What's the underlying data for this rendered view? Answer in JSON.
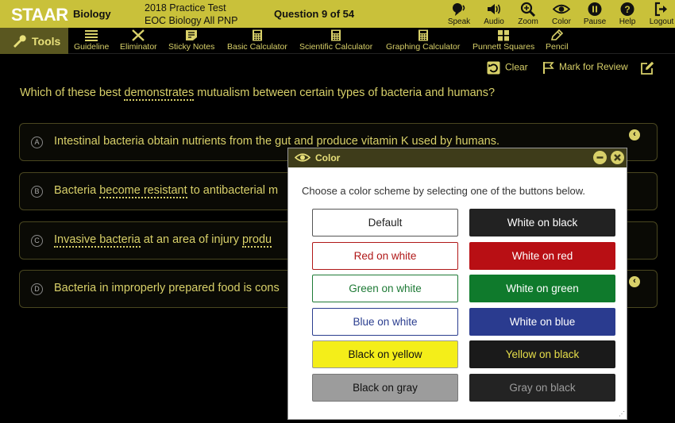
{
  "header": {
    "logo": "STAAR",
    "subject": "Biology",
    "test_line1": "2018 Practice Test",
    "test_line2": "EOC Biology All PNP",
    "question_count": "Question 9 of 54",
    "buttons": [
      {
        "label": "Speak",
        "icon": "speak-icon"
      },
      {
        "label": "Audio",
        "icon": "audio-icon"
      },
      {
        "label": "Zoom",
        "icon": "zoom-icon"
      },
      {
        "label": "Color",
        "icon": "eye-icon"
      },
      {
        "label": "Pause",
        "icon": "pause-icon"
      },
      {
        "label": "Help",
        "icon": "help-icon"
      },
      {
        "label": "Logout",
        "icon": "logout-icon"
      }
    ]
  },
  "toolbar": {
    "tools_label": "Tools",
    "items": [
      {
        "label": "Guideline",
        "icon": "guideline-icon"
      },
      {
        "label": "Eliminator",
        "icon": "eliminator-icon"
      },
      {
        "label": "Sticky Notes",
        "icon": "sticky-notes-icon"
      },
      {
        "label": "Basic Calculator",
        "icon": "calculator-icon"
      },
      {
        "label": "Scientific Calculator",
        "icon": "calculator-icon"
      },
      {
        "label": "Graphing Calculator",
        "icon": "calculator-icon"
      },
      {
        "label": "Punnett Squares",
        "icon": "grid-icon"
      },
      {
        "label": "Pencil",
        "icon": "pencil-icon"
      }
    ]
  },
  "actions": {
    "clear": "Clear",
    "mark_review": "Mark for Review"
  },
  "question": {
    "before": "Which of these best ",
    "underlined": "demonstrates",
    "after": " mutualism between certain types of bacteria and humans?"
  },
  "options": [
    {
      "letter": "A",
      "text": "Intestinal bacteria obtain nutrients from the gut and produce vitamin K used by humans."
    },
    {
      "letter": "B",
      "before": "Bacteria ",
      "underlined": "become resistant",
      "after": " to antibacterial m"
    },
    {
      "letter": "C",
      "underlined": "Invasive bacteria",
      "after": " at an area of injury ",
      "underlined2": "produ"
    },
    {
      "letter": "D",
      "text": "Bacteria in improperly prepared food is cons"
    }
  ],
  "dialog": {
    "title": "Color",
    "prompt": "Choose a color scheme by selecting one of the buttons below.",
    "schemes": [
      {
        "label": "Default",
        "bg": "#ffffff",
        "fg": "#222222",
        "border": "#555555"
      },
      {
        "label": "White on black",
        "bg": "#222222",
        "fg": "#ffffff",
        "border": "#222222"
      },
      {
        "label": "Red on white",
        "bg": "#ffffff",
        "fg": "#b01818",
        "border": "#b01818"
      },
      {
        "label": "White on red",
        "bg": "#b80f14",
        "fg": "#ffffff",
        "border": "#b80f14"
      },
      {
        "label": "Green on white",
        "bg": "#ffffff",
        "fg": "#1e7a36",
        "border": "#1e7a36"
      },
      {
        "label": "White on green",
        "bg": "#0f7a2c",
        "fg": "#ffffff",
        "border": "#0f7a2c"
      },
      {
        "label": "Blue on white",
        "bg": "#ffffff",
        "fg": "#2a3d8f",
        "border": "#2a3d8f"
      },
      {
        "label": "White on blue",
        "bg": "#2a3b8f",
        "fg": "#ffffff",
        "border": "#2a3b8f"
      },
      {
        "label": "Black on yellow",
        "bg": "#f4ee19",
        "fg": "#111111",
        "border": "#999999"
      },
      {
        "label": "Yellow on black",
        "bg": "#1a1a1a",
        "fg": "#e7df4a",
        "border": "#1a1a1a"
      },
      {
        "label": "Black on gray",
        "bg": "#9c9c9c",
        "fg": "#111111",
        "border": "#777777"
      },
      {
        "label": "Gray on black",
        "bg": "#232323",
        "fg": "#9c9c9c",
        "border": "#232323"
      }
    ]
  }
}
